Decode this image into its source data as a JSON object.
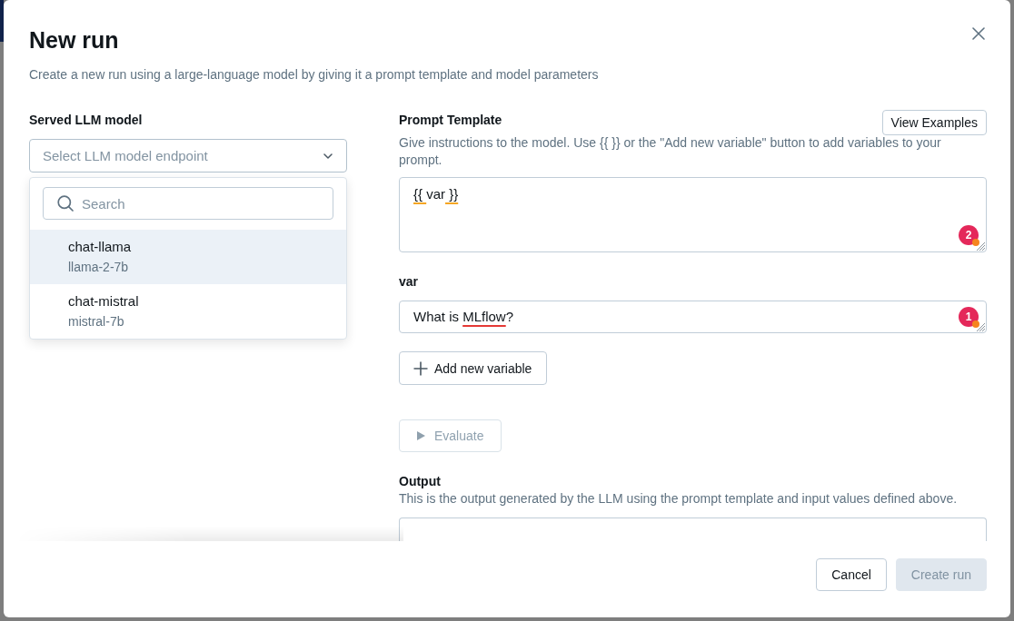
{
  "dialog": {
    "title": "New run",
    "description": "Create a new run using a large-language model by giving it a prompt template and model parameters"
  },
  "model_select": {
    "label": "Served LLM model",
    "placeholder": "Select LLM model endpoint",
    "expanded": true,
    "search": {
      "placeholder": "Search"
    },
    "options": [
      {
        "name": "chat-llama",
        "model": "llama-2-7b",
        "selected": true
      },
      {
        "name": "chat-mistral",
        "model": "mistral-7b",
        "selected": false
      }
    ]
  },
  "prompt_template": {
    "label": "Prompt Template",
    "button": "View Examples",
    "help": "Give instructions to the model. Use {{ }} or the \"Add new variable\" button to add variables to your prompt.",
    "value_parts": [
      {
        "text": "{{ ",
        "kind": "grammar"
      },
      {
        "text": "var",
        "kind": "plain"
      },
      {
        "text": " }}",
        "kind": "grammar"
      }
    ],
    "issue_count": "2"
  },
  "variables": [
    {
      "name": "var",
      "value_parts": [
        {
          "text": "What is ",
          "kind": "plain"
        },
        {
          "text": "MLflow",
          "kind": "spelling"
        },
        {
          "text": "?",
          "kind": "plain"
        }
      ],
      "issue_count": "1"
    }
  ],
  "add_variable_button": {
    "label": "Add new variable"
  },
  "evaluate_button": {
    "label": "Evaluate",
    "disabled": true
  },
  "output": {
    "label": "Output",
    "help": "This is the output generated by the LLM using the prompt template and input values defined above."
  },
  "footer": {
    "buttons": [
      {
        "label": "Cancel",
        "kind": "secondary",
        "disabled": false
      },
      {
        "label": "Create run",
        "kind": "primary",
        "disabled": true
      }
    ]
  }
}
